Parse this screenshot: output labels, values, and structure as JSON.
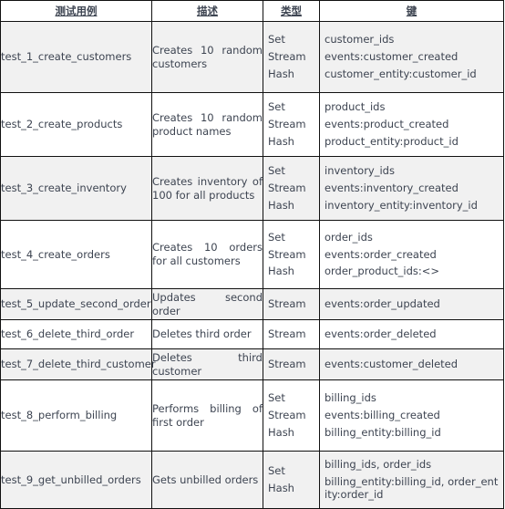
{
  "table": {
    "headers": [
      {
        "label": "测试用例",
        "name": "col-test-case"
      },
      {
        "label": "描述",
        "name": "col-description"
      },
      {
        "label": "类型",
        "name": "col-type"
      },
      {
        "label": "键",
        "name": "col-key"
      }
    ],
    "rows": [
      {
        "case": "test_1_create_customers",
        "desc": "Creates 10 random customers",
        "entries": [
          {
            "type": "Set",
            "key": "customer_ids"
          },
          {
            "type": "Stream",
            "key": "events:customer_created"
          },
          {
            "type": "Hash",
            "key": "customer_entity:customer_id"
          }
        ]
      },
      {
        "case": "test_2_create_products",
        "desc": "Creates 10 random product names",
        "entries": [
          {
            "type": "Set",
            "key": "product_ids"
          },
          {
            "type": "Stream",
            "key": "events:product_created"
          },
          {
            "type": "Hash",
            "key": "product_entity:product_id"
          }
        ]
      },
      {
        "case": "test_3_create_inventory",
        "desc": "Creates inventory of 100 for all products",
        "entries": [
          {
            "type": "Set",
            "key": "inventory_ids"
          },
          {
            "type": "Stream",
            "key": "events:inventory_created"
          },
          {
            "type": "Hash",
            "key": "inventory_entity:inventory_id"
          }
        ]
      },
      {
        "case": "test_4_create_orders",
        "desc": "Creates 10 orders for all customers",
        "entries": [
          {
            "type": "Set",
            "key": "order_ids"
          },
          {
            "type": "Stream",
            "key": "events:order_created"
          },
          {
            "type": "Hash",
            "key": "order_product_ids:<>"
          }
        ]
      },
      {
        "case": "test_5_update_second_order",
        "desc": "Updates second order",
        "entries": [
          {
            "type": "Stream",
            "key": "events:order_updated"
          }
        ]
      },
      {
        "case": "test_6_delete_third_order",
        "desc": "Deletes third order",
        "entries": [
          {
            "type": "Stream",
            "key": "events:order_deleted"
          }
        ]
      },
      {
        "case": "test_7_delete_third_customer",
        "desc": "Deletes third customer",
        "entries": [
          {
            "type": "Stream",
            "key": "events:customer_deleted"
          }
        ]
      },
      {
        "case": "test_8_perform_billing",
        "desc": "Performs billing of first order",
        "entries": [
          {
            "type": "Set",
            "key": "billing_ids"
          },
          {
            "type": "Stream",
            "key": "events:billing_created"
          },
          {
            "type": "Hash",
            "key": "billing_entity:billing_id"
          }
        ]
      },
      {
        "case": "test_9_get_unbilled_orders",
        "desc": "Gets unbilled orders",
        "entries": [
          {
            "type": "Set",
            "key": "billing_ids, order_ids"
          },
          {
            "type": "Hash",
            "key": "billing_entity:billing_id, order_entity:order_id"
          }
        ]
      }
    ]
  },
  "colors": {
    "border": "#111111",
    "shaded_row": "#f1f1f1",
    "plain_row": "#ffffff",
    "text": "#3d4451"
  }
}
